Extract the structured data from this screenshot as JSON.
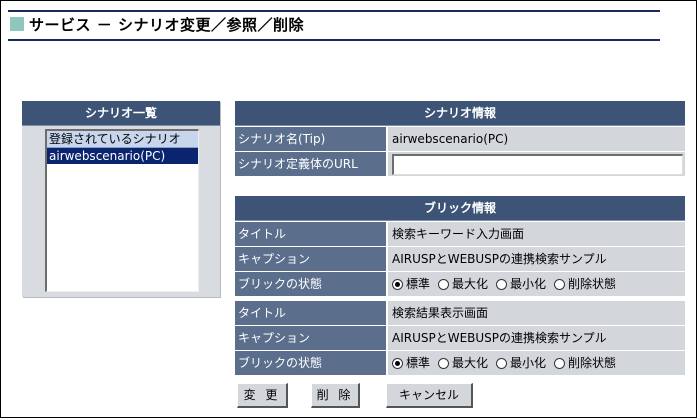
{
  "page": {
    "title": "サービス － シナリオ変更／参照／削除"
  },
  "scenario_list": {
    "header": "シナリオ一覧",
    "items": [
      "登録されているシナリオ",
      "airwebscenario(PC)"
    ]
  },
  "scenario_info": {
    "header": "シナリオ情報",
    "name_label": "シナリオ名(Tip)",
    "name_value": "airwebscenario(PC)",
    "url_label": "シナリオ定義体のURL",
    "url_value": ""
  },
  "brick_info": {
    "header": "ブリック情報",
    "bricks": [
      {
        "title_label": "タイトル",
        "title_value": "検索キーワード入力画面",
        "caption_label": "キャプション",
        "caption_value": "AIRUSPとWEBUSPの連携検索サンプル",
        "state_label": "ブリックの状態",
        "states": [
          "標準",
          "最大化",
          "最小化",
          "削除状態"
        ],
        "selected_state": "標準"
      },
      {
        "title_label": "タイトル",
        "title_value": "検索結果表示画面",
        "caption_label": "キャプション",
        "caption_value": "AIRUSPとWEBUSPの連携検索サンプル",
        "state_label": "ブリックの状態",
        "states": [
          "標準",
          "最大化",
          "最小化",
          "削除状態"
        ],
        "selected_state": "標準"
      }
    ]
  },
  "buttons": {
    "change": "変 更",
    "delete": "削 除",
    "cancel": "キャンセル"
  },
  "colors": {
    "header_bg": "#3d5477",
    "label_bg": "#5b6f8d",
    "value_bg": "#d3d6db",
    "title_square": "#8fc6be",
    "selected_item": "#0a2470"
  }
}
